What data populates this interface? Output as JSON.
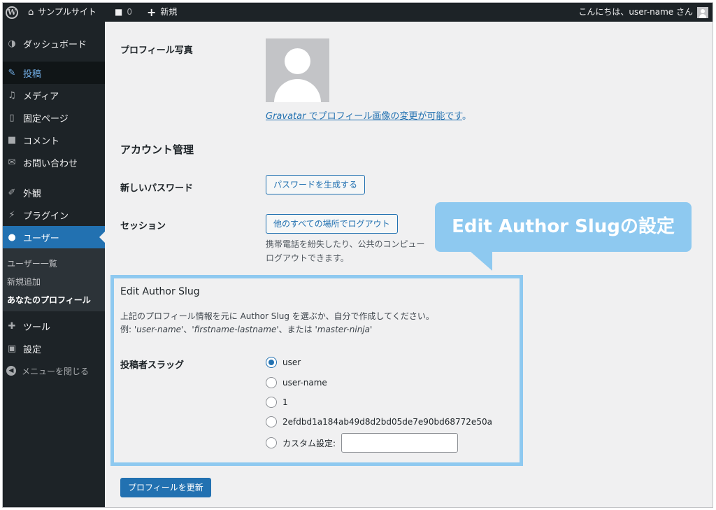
{
  "adminbar": {
    "site_name": "サンプルサイト",
    "comments_count": "0",
    "new_label": "新規",
    "greeting": "こんにちは、user-name さん"
  },
  "sidebar": {
    "items": [
      {
        "label": "ダッシュボード",
        "icon": "dashboard-icon"
      },
      {
        "label": "投稿",
        "icon": "pin-icon"
      },
      {
        "label": "メディア",
        "icon": "media-icon"
      },
      {
        "label": "固定ページ",
        "icon": "page-icon"
      },
      {
        "label": "コメント",
        "icon": "comment-icon"
      },
      {
        "label": "お問い合わせ",
        "icon": "mail-icon"
      },
      {
        "label": "外観",
        "icon": "brush-icon"
      },
      {
        "label": "プラグイン",
        "icon": "plugin-icon"
      },
      {
        "label": "ユーザー",
        "icon": "user-icon"
      },
      {
        "label": "ツール",
        "icon": "wrench-icon"
      },
      {
        "label": "設定",
        "icon": "settings-icon"
      }
    ],
    "submenu": [
      "ユーザー一覧",
      "新規追加",
      "あなたのプロフィール"
    ],
    "collapse_label": "メニューを閉じる"
  },
  "profile": {
    "photo_label": "プロフィール写真",
    "gravatar_link": "Gravatar",
    "gravatar_text": " でプロフィール画像の変更が可能です",
    "gravatar_period": "。",
    "account_heading": "アカウント管理",
    "new_password_label": "新しいパスワード",
    "generate_password_button": "パスワードを生成する",
    "sessions_label": "セッション",
    "logout_everywhere_button": "他のすべての場所でログアウト",
    "sessions_desc_line1": "携帯電話を紛失したり、公共のコンピュー",
    "sessions_desc_line2": "ログアウトできます。"
  },
  "callout": {
    "text": "Edit Author Slugの設定"
  },
  "author_slug": {
    "title": "Edit Author Slug",
    "desc_line1": "上記のプロフィール情報を元に Author Slug を選ぶか、自分で作成してください。",
    "example_prefix": "例: ",
    "example_1": "'user-name'",
    "sep_1": "、",
    "example_2": "'firstname-lastname'",
    "sep_2": "、または ",
    "example_3": "'master-ninja'",
    "slug_label": "投稿者スラッグ",
    "options": [
      "user",
      "user-name",
      "1",
      "2efdbd1a184ab49d8d2bd05de7e90bd68772e50a",
      "カスタム設定:"
    ],
    "selected": "user",
    "custom_value": ""
  },
  "update_button": "プロフィールを更新",
  "colors": {
    "admin_dark": "#1d2327",
    "accent_blue": "#2271b1",
    "callout_blue": "#8ec9f0"
  }
}
